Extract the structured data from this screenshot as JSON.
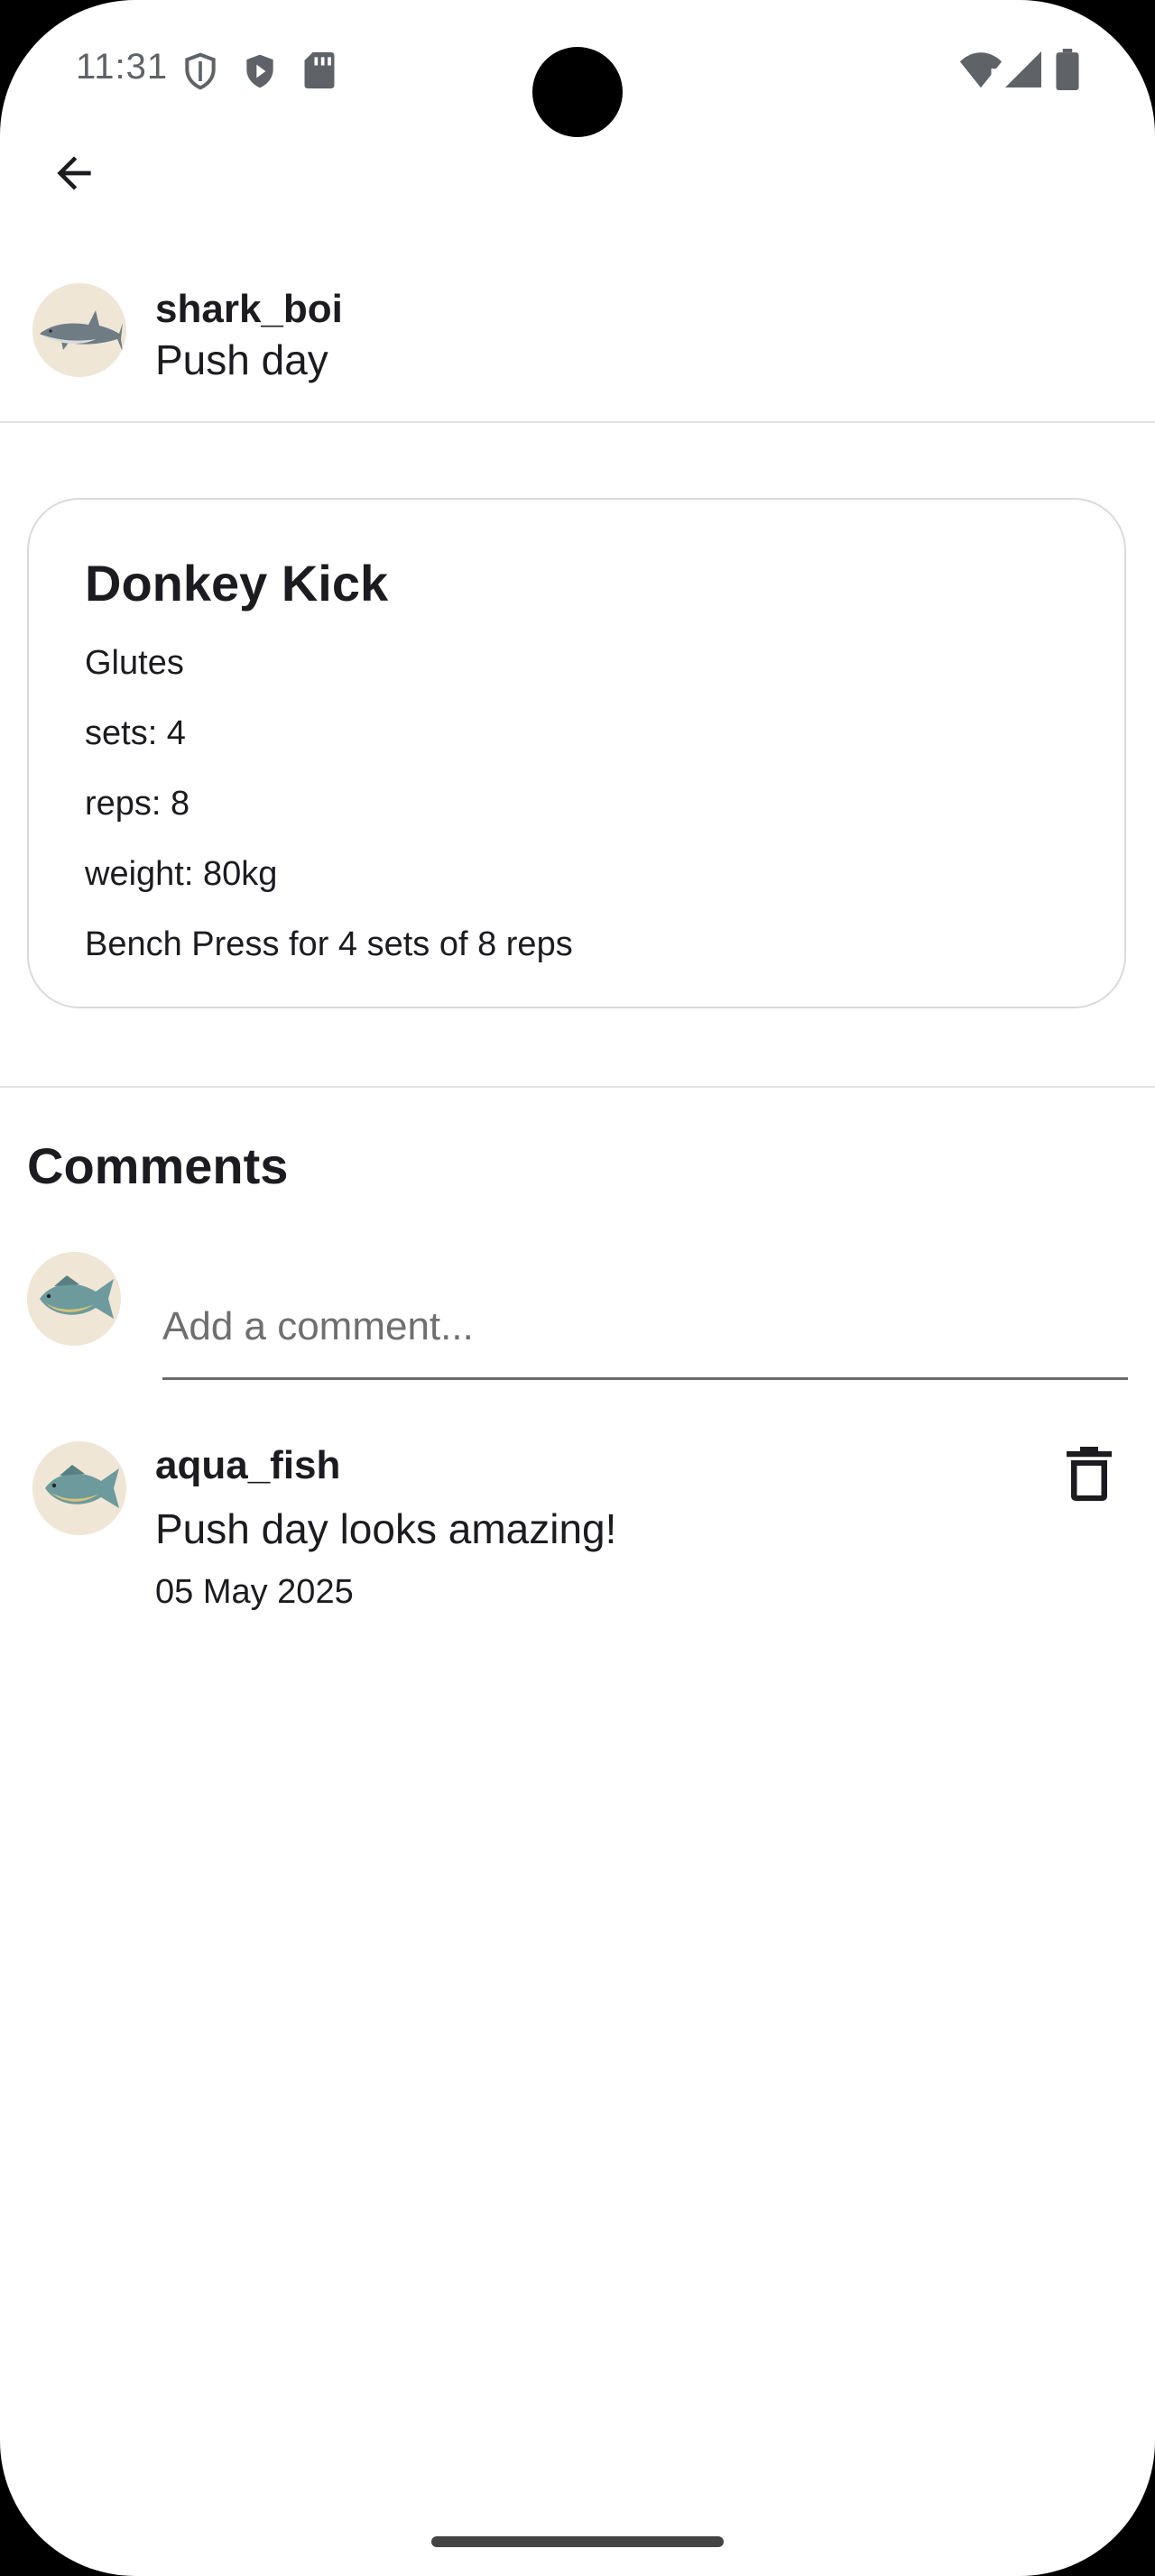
{
  "status_bar": {
    "time": "11:31",
    "icons": [
      "vpn-shield-icon",
      "play-protect-icon",
      "sd-card-icon",
      "wifi-alert-icon",
      "cell-signal-icon",
      "battery-icon"
    ]
  },
  "app_bar": {
    "back_icon": "arrow-back-icon"
  },
  "post": {
    "username": "shark_boi",
    "title": "Push day",
    "avatar_icon": "shark-avatar"
  },
  "exercise": {
    "name": "Donkey Kick",
    "muscle": "Glutes",
    "sets": "sets: 4",
    "reps": "reps: 8",
    "weight": "weight: 80kg",
    "description": "Bench Press for 4 sets of 8 reps"
  },
  "comments": {
    "heading": "Comments",
    "input_placeholder": "Add a comment...",
    "current_user_avatar": "fish-avatar",
    "items": [
      {
        "username": "aqua_fish",
        "text": "Push day looks amazing!",
        "date": "05 May 2025",
        "avatar": "fish-avatar",
        "delete_icon": "trash-icon"
      }
    ]
  },
  "colors": {
    "background": "#ffffff",
    "text": "#1c1b1f",
    "divider": "#e2e2e2",
    "card_border": "#dadada",
    "avatar_bg": "#efe6d6"
  }
}
